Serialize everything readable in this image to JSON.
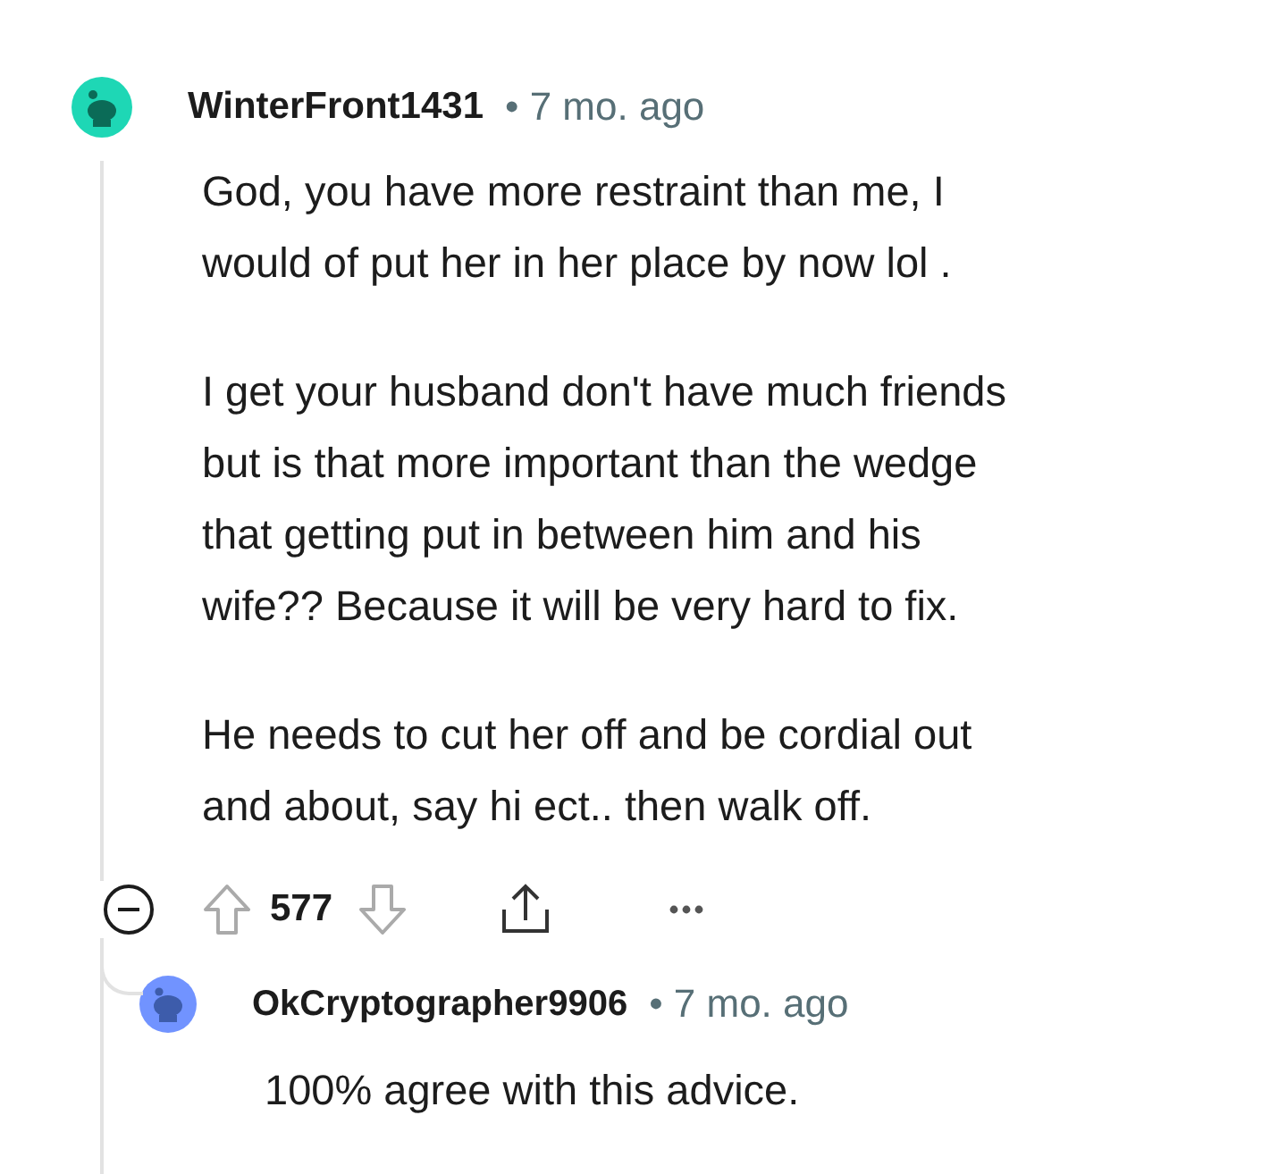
{
  "comment": {
    "author": "WinterFront1431",
    "time": "• 7 mo. ago",
    "paragraphs": [
      {
        "lines": [
          "God, you have more restraint than me, I",
          "would of put her in her place by now lol ."
        ]
      },
      {
        "lines": [
          "I get your husband don't have much friends",
          "but is that more important than the wedge",
          "that getting put in between him and his",
          "wife?? Because it will be very hard to fix."
        ]
      },
      {
        "lines": [
          "He needs to cut her off and be cordial out",
          "and about, say hi ect.. then walk off."
        ]
      }
    ],
    "score": "577",
    "reply": {
      "author": "OkCryptographer9906",
      "time": "• 7 mo. ago",
      "text": "100% agree with this advice."
    }
  }
}
